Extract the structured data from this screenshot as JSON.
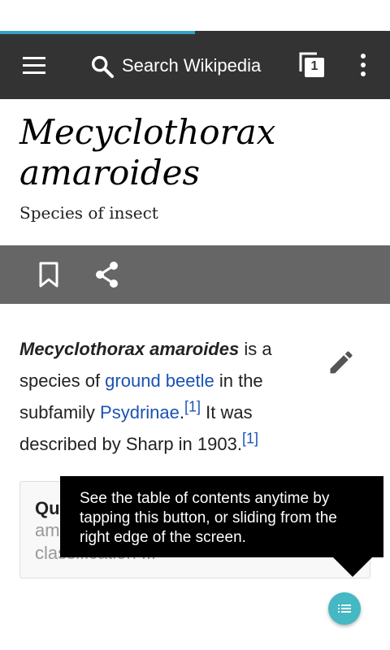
{
  "toolbar": {
    "search_placeholder": "Search Wikipedia",
    "tab_count": "1",
    "load_progress": 0.5
  },
  "article": {
    "title": "Mecyclothorax amaroides",
    "description": "Species of insect",
    "lead": {
      "bold_name": "Mecyclothorax amaroides",
      "text_1": " is a species of ",
      "link_1": "ground beetle",
      "text_2": " in the subfamily ",
      "link_2": "Psydrinae",
      "text_3": ".",
      "ref_1": "[1]",
      "text_4": " It was described by Sharp in 1903.",
      "ref_2": "[1]"
    }
  },
  "card": {
    "title": "Qu",
    "text": "am\nclassification ..."
  },
  "tooltip": {
    "text": "See the table of contents anytime by tapping this button, or sliding from the right edge of the screen."
  },
  "colors": {
    "toolbar": "#333333",
    "action_bar": "#666666",
    "link": "#1b52b5",
    "fab": "#44b8c3",
    "progress": "#36a1c8"
  }
}
